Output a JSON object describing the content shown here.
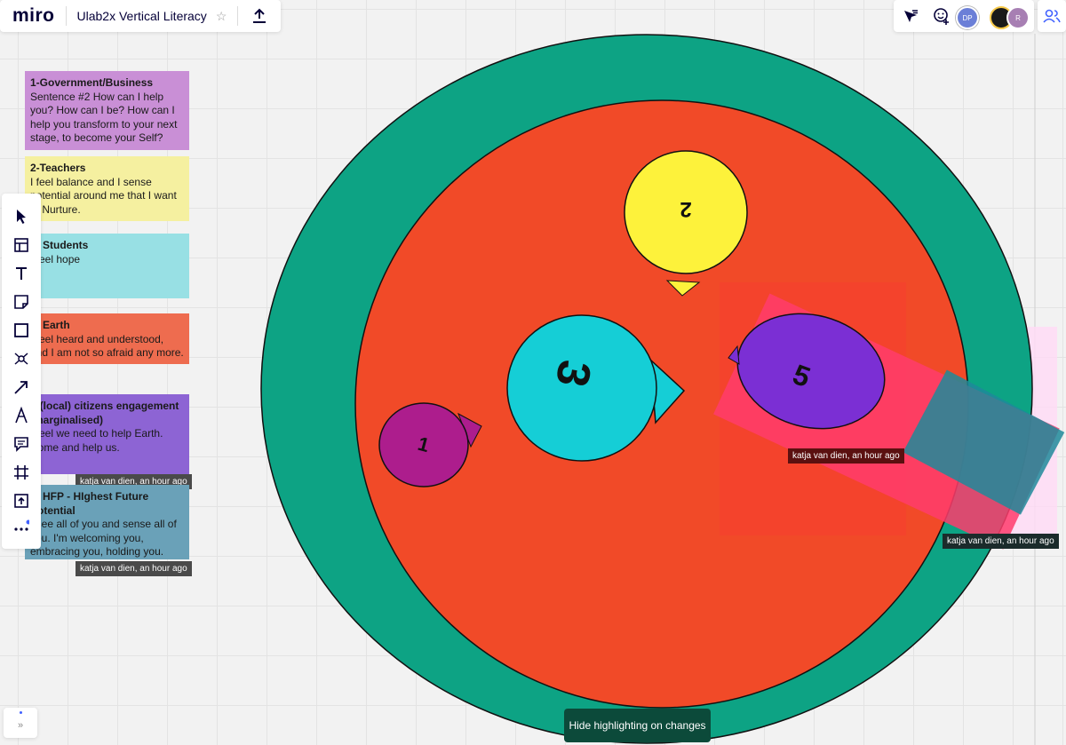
{
  "app": {
    "logo": "miro",
    "board_title": "Ulab2x Vertical Literacy"
  },
  "header": {
    "collaborators": [
      {
        "initials": "DP",
        "color": "#6b7fd7"
      },
      {
        "initials": "",
        "color": "#1a1a1a"
      },
      {
        "initials": "R",
        "color": "#a77fb3"
      }
    ]
  },
  "stickies": [
    {
      "title": "1-Government/Business",
      "body": "Sentence #2 How can I help you? How can I be? How can I help you transform to your next stage, to become your Self?",
      "color": "#c98fd6"
    },
    {
      "title": "2-Teachers",
      "body": "I feel balance and I sense potential around me that I want to Nurture.",
      "color": "#f5f0a0"
    },
    {
      "title": "3- Students",
      "body": "I feel hope",
      "color": "#98e0e4"
    },
    {
      "title": "4- Earth",
      "body": "I feel heard and understood, and I am not so afraid any more.",
      "color": "#ee6c4f"
    },
    {
      "title": "5-(local) citizens engagement (marginalised)",
      "body": "I feel we need to help Earth. Come and help us.",
      "color": "#8d64d4"
    },
    {
      "title": "6- HFP - HIghest Future Potential",
      "body": "I see all of you and sense all of you. I'm welcoming you, embracing you, holding you.",
      "color": "#6aa1b8"
    }
  ],
  "canvas": {
    "circle_labels": [
      "1",
      "2",
      "3",
      "5"
    ],
    "colors": {
      "outer": "#0da384",
      "inner": "#f14a28",
      "yellow": "#fdf23b",
      "cyan": "#15ced6",
      "magenta": "#ad1d8d",
      "purple": "#7b2fd4",
      "pink": "#ff3c6c"
    }
  },
  "stamps": {
    "sticky5": "katja van dien, an hour ago",
    "sticky6": "katja van dien, an hour ago",
    "canvas1": "katja van dien, an hour ago",
    "canvas2": "katja van dien, an hour ago"
  },
  "toast": {
    "label": "Hide highlighting on changes"
  },
  "collapse_label": "»"
}
